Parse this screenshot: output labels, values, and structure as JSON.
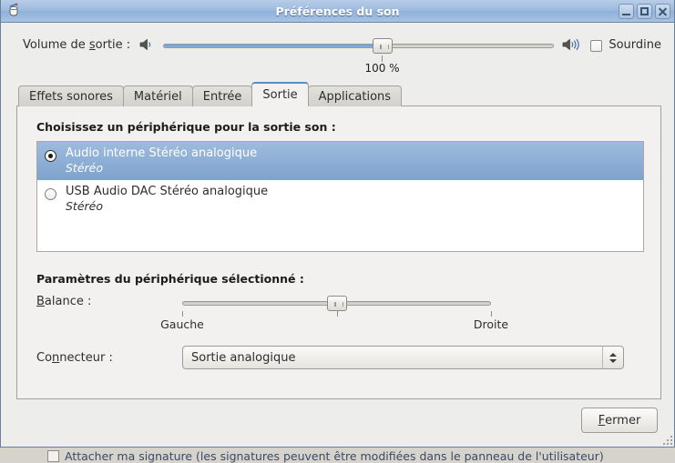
{
  "window": {
    "title": "Préférences du son",
    "icon": "speaker-icon",
    "buttons": {
      "minimize": "minimize-icon",
      "maximize": "maximize-icon",
      "close": "close-icon"
    }
  },
  "volume": {
    "label_pre": "Volume de ",
    "label_mn": "s",
    "label_post": "ortie :",
    "low_icon": "volume-low-icon",
    "high_icon": "volume-high-icon",
    "value_text": "100 %",
    "value_percent": 100,
    "thumb_position_percent": 56,
    "fill_percent": 56,
    "mute_label": "Sourdine",
    "mute_checked": false
  },
  "tabs": [
    {
      "label": "Effets sonores",
      "active": false
    },
    {
      "label": "Matériel",
      "active": false
    },
    {
      "label": "Entrée",
      "active": false
    },
    {
      "label": "Sortie",
      "active": true
    },
    {
      "label": "Applications",
      "active": false
    }
  ],
  "output_panel": {
    "choose_title": "Choisissez un périphérique pour la sortie son :",
    "devices": [
      {
        "name": "Audio interne Stéréo analogique",
        "detail": "Stéréo",
        "selected": true
      },
      {
        "name": "USB Audio DAC   Stéréo analogique",
        "detail": "Stéréo",
        "selected": false
      }
    ],
    "params_title": "Paramètres du périphérique sélectionné :",
    "balance": {
      "label_mn": "B",
      "label_rest": "alance :",
      "left_label": "Gauche",
      "right_label": "Droite",
      "thumb_position_percent": 50
    },
    "connector": {
      "label_pre": "Co",
      "label_mn": "n",
      "label_post": "necteur :",
      "value": "Sortie analogique",
      "arrow_icon": "chevron-updown-icon"
    }
  },
  "footer": {
    "close_mn": "F",
    "close_rest": "ermer"
  },
  "background_window": {
    "text": "Attacher ma signature (les signatures peuvent être modifiées dans le panneau de l'utilisateur)",
    "checked": false
  },
  "colors": {
    "titlebar": "#9cbadf",
    "selection": "#7ea3ce",
    "active_tab_accent": "#5a8cc8",
    "slider_fill": "#6d9fd6",
    "dialog_bg": "#ededeb",
    "panel_bg": "#f2f1ef"
  }
}
